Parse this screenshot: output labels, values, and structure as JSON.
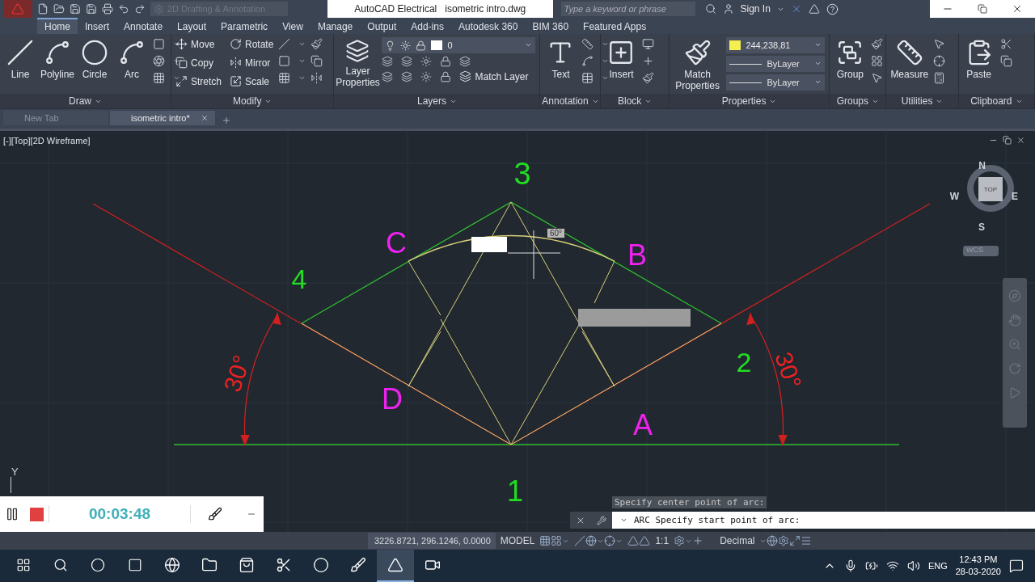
{
  "title_bar": {
    "workspace": "2D Drafting & Annotation",
    "app": "AutoCAD Electrical",
    "file": "isometric intro.dwg",
    "search": {
      "placeholder": "Type a keyword or phrase"
    },
    "sign_in": "Sign In"
  },
  "ribbon_tabs": [
    {
      "label": "Home",
      "selected": true
    },
    {
      "label": "Insert",
      "selected": false
    },
    {
      "label": "Annotate",
      "selected": false
    },
    {
      "label": "Layout",
      "selected": false
    },
    {
      "label": "Parametric",
      "selected": false
    },
    {
      "label": "View",
      "selected": false
    },
    {
      "label": "Manage",
      "selected": false
    },
    {
      "label": "Output",
      "selected": false
    },
    {
      "label": "Add-ins",
      "selected": false
    },
    {
      "label": "Autodesk 360",
      "selected": false
    },
    {
      "label": "BIM 360",
      "selected": false
    },
    {
      "label": "Featured Apps",
      "selected": false
    }
  ],
  "panels": [
    {
      "title": "Draw",
      "items": [
        {
          "kind": "large",
          "label": "Line"
        },
        {
          "kind": "large",
          "label": "Polyline"
        },
        {
          "kind": "large",
          "label": "Circle"
        },
        {
          "kind": "large",
          "label": "Arc"
        }
      ]
    },
    {
      "title": "Modify",
      "items": [
        {
          "kind": "small",
          "label": "Move"
        },
        {
          "kind": "small",
          "label": "Rotate"
        },
        {
          "kind": "small",
          "label": "Copy"
        },
        {
          "kind": "small",
          "label": "Mirror"
        },
        {
          "kind": "small",
          "label": "Stretch"
        },
        {
          "kind": "small",
          "label": "Scale"
        }
      ]
    },
    {
      "title": "Layers",
      "items": [
        {
          "kind": "large",
          "label": "Layer Properties"
        },
        {
          "kind": "combo",
          "label": "0"
        },
        {
          "kind": "small",
          "label": "Match Layer"
        }
      ]
    },
    {
      "title": "Annotation",
      "items": [
        {
          "kind": "large",
          "label": "Text"
        }
      ]
    },
    {
      "title": "Block",
      "items": [
        {
          "kind": "large",
          "label": "Insert"
        }
      ]
    },
    {
      "title": "Properties",
      "items": [
        {
          "kind": "large",
          "label": "Match Properties"
        },
        {
          "kind": "combo",
          "label": "244,238,81",
          "color": "#f4ee51"
        },
        {
          "kind": "combo",
          "label": "ByLayer"
        },
        {
          "kind": "combo",
          "label": "ByLayer"
        }
      ]
    },
    {
      "title": "Groups",
      "items": [
        {
          "kind": "large",
          "label": "Group"
        }
      ]
    },
    {
      "title": "Utilities",
      "items": [
        {
          "kind": "large",
          "label": "Measure"
        }
      ]
    },
    {
      "title": "Clipboard",
      "items": [
        {
          "kind": "large",
          "label": "Paste"
        }
      ]
    }
  ],
  "file_tabs": [
    {
      "label": "New Tab",
      "selected": false
    },
    {
      "label": "isometric intro*",
      "selected": true
    }
  ],
  "viewport": {
    "label": "[-][Top][2D Wireframe]",
    "viewcube": {
      "north": "N",
      "south": "S",
      "west": "W",
      "east": "E",
      "face": "TOP",
      "ucs": "WCS"
    },
    "axis": "Y"
  },
  "drawing": {
    "labels": [
      {
        "text": "3",
        "color": "#22dd22"
      },
      {
        "text": "C",
        "color": "#ee22ee"
      },
      {
        "text": "B",
        "color": "#ee22ee"
      },
      {
        "text": "4",
        "color": "#22dd22"
      },
      {
        "text": "2",
        "color": "#22dd22"
      },
      {
        "text": "D",
        "color": "#ee22ee"
      },
      {
        "text": "A",
        "color": "#ee22ee"
      },
      {
        "text": "1",
        "color": "#22dd22"
      },
      {
        "text": "30°",
        "color": "#ee2222"
      },
      {
        "text": "30°",
        "color": "#ee2222"
      }
    ],
    "angle_tip": "60°"
  },
  "command_line": {
    "history": "Specify center point of arc:",
    "prompt": "ARC Specify start point of arc:"
  },
  "recorder": {
    "time": "00:03:48"
  },
  "status_bar": {
    "coordinates": "3226.8721, 296.1246, 0.0000",
    "space": "MODEL",
    "scale": "1:1",
    "units": "Decimal"
  },
  "taskbar": {
    "apps": [
      {
        "selected": false
      },
      {
        "selected": false
      },
      {
        "selected": false
      },
      {
        "selected": false
      },
      {
        "selected": false
      },
      {
        "selected": false
      },
      {
        "selected": true
      },
      {
        "selected": false
      }
    ],
    "language": "ENG",
    "time": "12:43 PM",
    "date": "28-03-2020"
  }
}
